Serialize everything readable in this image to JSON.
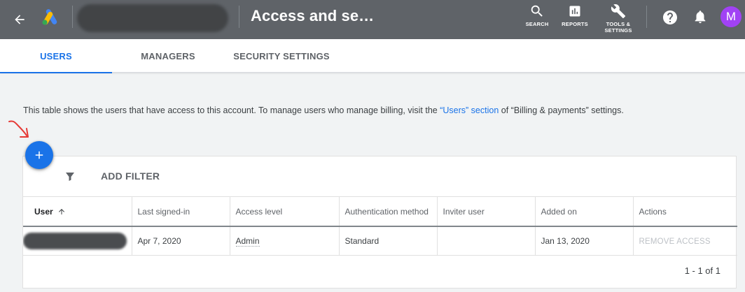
{
  "header": {
    "title": "Access and se…",
    "icons": {
      "back": "arrow-back-icon",
      "logo": "google-ads-logo",
      "help": "help-icon",
      "notifications": "bell-icon"
    },
    "nav": [
      {
        "label": "SEARCH",
        "icon": "search-icon"
      },
      {
        "label": "REPORTS",
        "icon": "reports-icon"
      },
      {
        "label": "TOOLS &\nSETTINGS",
        "icon": "wrench-icon"
      }
    ],
    "avatar_letter": "M"
  },
  "tabs": [
    {
      "label": "USERS",
      "active": true
    },
    {
      "label": "MANAGERS",
      "active": false
    },
    {
      "label": "SECURITY SETTINGS",
      "active": false
    }
  ],
  "intro": {
    "text_before": "This table shows the users that have access to this account. To manage users who manage billing, visit the ",
    "link": "“Users” section",
    "text_after": " of “Billing & payments” settings."
  },
  "filter": {
    "label": "ADD FILTER",
    "icon": "filter-icon"
  },
  "fab": {
    "icon": "plus-icon"
  },
  "table": {
    "columns": [
      "User",
      "Last signed-in",
      "Access level",
      "Authentication method",
      "Inviter user",
      "Added on",
      "Actions"
    ],
    "rows": [
      {
        "user": "",
        "last_signed_in": "Apr 7, 2020",
        "access_level": "Admin",
        "auth_method": "Standard",
        "inviter": "",
        "added_on": "Jan 13, 2020",
        "action": "REMOVE ACCESS"
      }
    ]
  },
  "pagination": "1 - 1 of 1",
  "colors": {
    "topbar": "#5f6368",
    "accent": "#1a73e8",
    "avatar": "#a142f4",
    "annotation": "#e53935"
  }
}
